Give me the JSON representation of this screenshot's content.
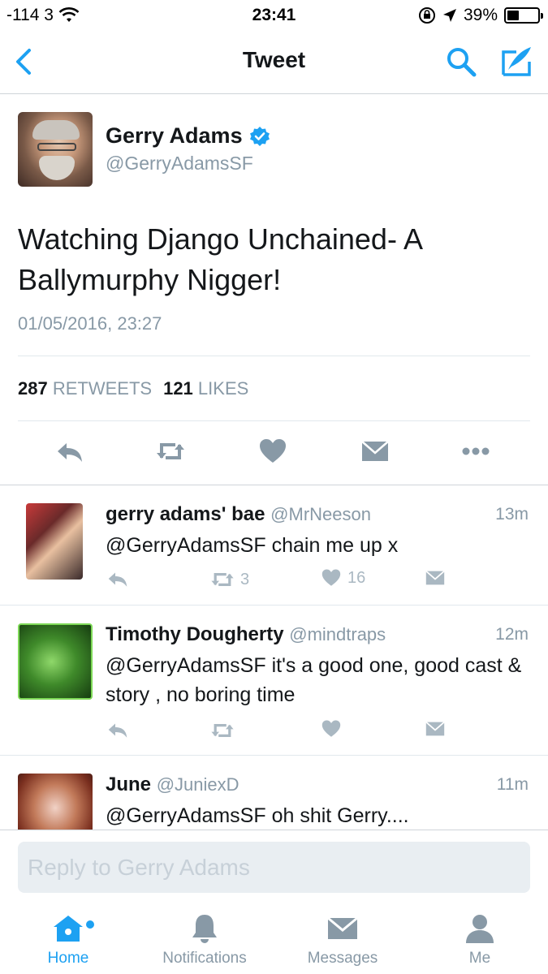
{
  "status_bar": {
    "signal": "-114 3",
    "time": "23:41",
    "battery": "39%",
    "battery_level": 0.39
  },
  "nav": {
    "title": "Tweet"
  },
  "tweet": {
    "author_name": "Gerry Adams",
    "author_handle": "@GerryAdamsSF",
    "text_line1": "Watching Django Unchained- A",
    "text_line2": "Ballymurphy Nigger!",
    "date": "01/05/2016, 23:27",
    "retweet_count": "287",
    "retweet_label": "RETWEETS",
    "like_count": "121",
    "like_label": "LIKES"
  },
  "replies": [
    {
      "name": "gerry adams' bae",
      "handle": "@MrNeeson",
      "time": "13m",
      "text": "@GerryAdamsSF chain me up x",
      "retweets": "3",
      "likes": "16"
    },
    {
      "name": "Timothy Dougherty",
      "handle": "@mindtraps",
      "time": "12m",
      "text": "@GerryAdamsSF  it's a good one, good cast & story , no boring time",
      "retweets": "",
      "likes": ""
    },
    {
      "name": "June",
      "handle": "@JuniexD",
      "time": "11m",
      "text": "@GerryAdamsSF oh shit Gerry....",
      "retweets": "",
      "likes": ""
    }
  ],
  "composer": {
    "placeholder": "Reply to Gerry Adams"
  },
  "tabs": [
    {
      "label": "Home",
      "icon": "home-icon"
    },
    {
      "label": "Notifications",
      "icon": "bell-icon"
    },
    {
      "label": "Messages",
      "icon": "envelope-icon"
    },
    {
      "label": "Me",
      "icon": "person-icon"
    }
  ],
  "colors": {
    "accent": "#1da1f2",
    "muted": "#8899a6",
    "icon_gray": "#aab8c2"
  }
}
